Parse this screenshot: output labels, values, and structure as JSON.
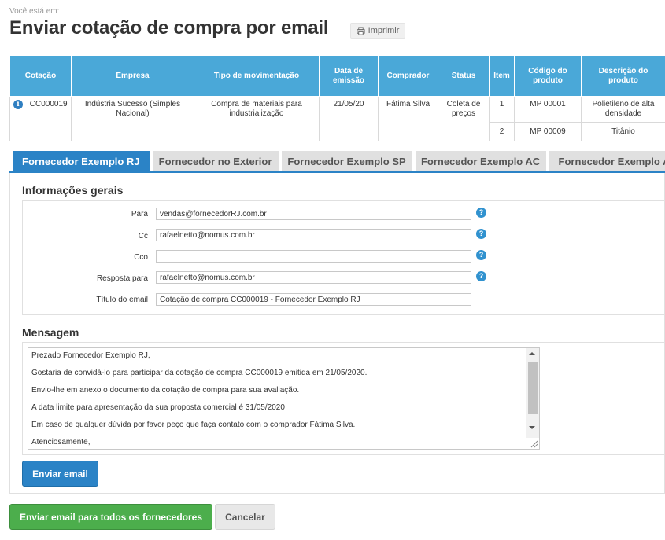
{
  "breadcrumb": {
    "label": "Você está em:"
  },
  "page": {
    "title": "Enviar cotação de compra por email",
    "print_label": "Imprimir"
  },
  "table": {
    "headers": [
      "Cotação",
      "Empresa",
      "Tipo de movimentação",
      "Data de emissão",
      "Comprador",
      "Status",
      "Item",
      "Código do produto",
      "Descrição do produto"
    ],
    "row": {
      "cotacao": "CC000019",
      "empresa": "Indústria Sucesso (Simples Nacional)",
      "tipo": "Compra de materiais para industrialização",
      "data": "21/05/20",
      "comprador": "Fátima Silva",
      "status": "Coleta de preços",
      "items": [
        {
          "item": "1",
          "codigo": "MP 00001",
          "descricao": "Polietileno de alta densidade"
        },
        {
          "item": "2",
          "codigo": "MP 00009",
          "descricao": "Titânio"
        }
      ]
    }
  },
  "tabs": [
    {
      "label": "Fornecedor Exemplo RJ",
      "active": true
    },
    {
      "label": "Fornecedor no Exterior",
      "active": false
    },
    {
      "label": "Fornecedor Exemplo SP",
      "active": false
    },
    {
      "label": "Fornecedor Exemplo AC",
      "active": false
    },
    {
      "label": "Fornecedor Exemplo AL",
      "active": false
    }
  ],
  "general_info": {
    "title": "Informações gerais",
    "para": {
      "label": "Para",
      "value": "vendas@fornecedorRJ.com.br"
    },
    "cc": {
      "label": "Cc",
      "value": "rafaelnetto@nomus.com.br"
    },
    "cco": {
      "label": "Cco",
      "value": ""
    },
    "resposta": {
      "label": "Resposta para",
      "value": "rafaelnetto@nomus.com.br"
    },
    "titulo": {
      "label": "Título do email",
      "value": "Cotação de compra CC000019 - Fornecedor Exemplo RJ"
    },
    "help_glyph": "?"
  },
  "message": {
    "title": "Mensagem",
    "lines": [
      "Prezado Fornecedor Exemplo RJ,",
      "Gostaria de convidá-lo para participar da cotação de compra CC000019 emitida em 21/05/2020.",
      "Envio-lhe em anexo o documento da cotação de compra para sua avaliação.",
      "A data limite para apresentação da sua proposta comercial é 31/05/2020",
      "Em caso de qualquer dúvida por favor peço que faça contato com o comprador Fátima Silva.",
      "Atenciosamente,"
    ]
  },
  "buttons": {
    "send": "Enviar email",
    "send_all": "Enviar email para todos os fornecedores",
    "cancel": "Cancelar"
  },
  "colors": {
    "header_bg": "#4aa8d8",
    "primary": "#2b83c6",
    "success": "#4cae4c",
    "tab_inactive": "#e0e0e0"
  },
  "icons": {
    "info": "info-icon",
    "print": "printer-icon",
    "help": "help-icon"
  }
}
